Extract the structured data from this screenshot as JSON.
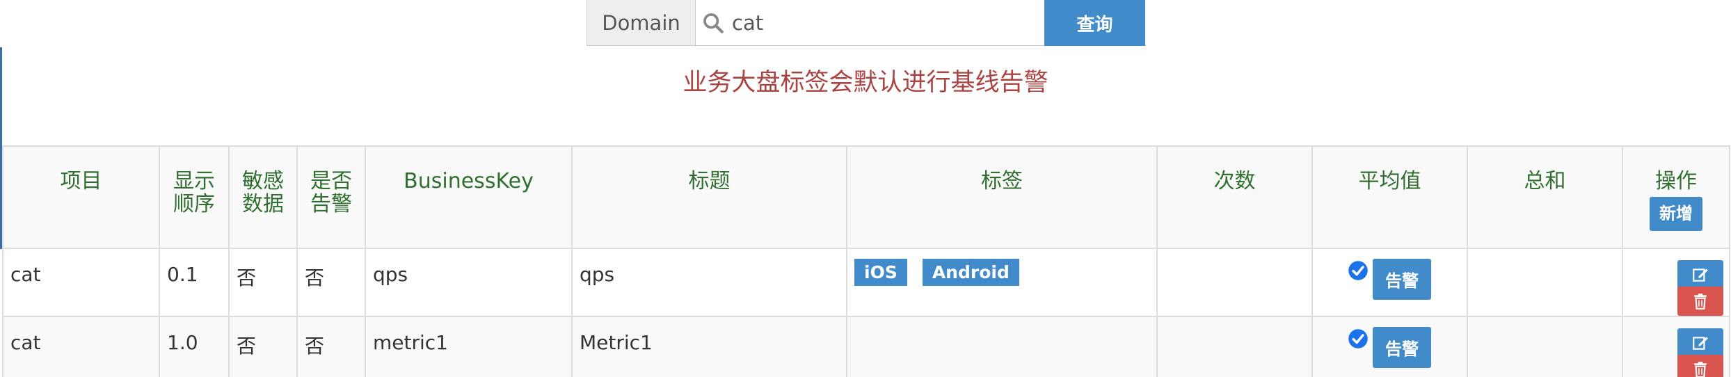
{
  "search": {
    "addon_label": "Domain",
    "value": "cat",
    "button_label": "查询"
  },
  "notice": "业务大盘标签会默认进行基线告警",
  "table": {
    "headers": {
      "item": "项目",
      "order": "显示\n顺序",
      "sensitive": "敏感\n数据",
      "alarm": "是否\n告警",
      "business_key": "BusinessKey",
      "title": "标题",
      "tags": "标签",
      "count": "次数",
      "avg": "平均值",
      "sum": "总和",
      "ops": "操作",
      "add_label": "新增"
    },
    "rows": [
      {
        "item": "cat",
        "order": "0.1",
        "sensitive": "否",
        "alarm": "否",
        "business_key": "qps",
        "title": "qps",
        "tags": [
          "iOS",
          "Android"
        ],
        "avg_checked": true,
        "alarm_btn": "告警"
      },
      {
        "item": "cat",
        "order": "1.0",
        "sensitive": "否",
        "alarm": "否",
        "business_key": "metric1",
        "title": "Metric1",
        "tags": [],
        "avg_checked": true,
        "alarm_btn": "告警"
      }
    ]
  },
  "colors": {
    "primary": "#428bca",
    "danger": "#d9534f",
    "header_text": "#2f6f2f",
    "notice_text": "#a94442"
  },
  "icons": {
    "search": "search-icon",
    "check": "check-circle-icon",
    "edit": "edit-icon",
    "delete": "trash-icon"
  }
}
